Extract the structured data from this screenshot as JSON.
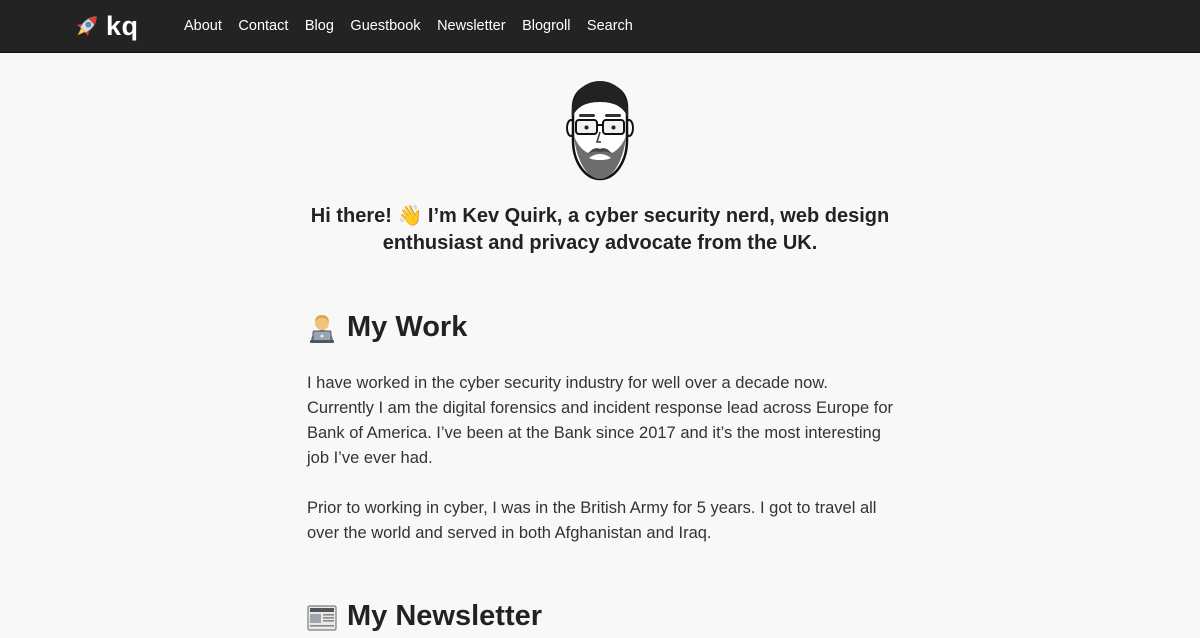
{
  "header": {
    "logo_text": "kq",
    "logo_icon": "rocket-icon",
    "nav": [
      {
        "label": "About"
      },
      {
        "label": "Contact"
      },
      {
        "label": "Blog"
      },
      {
        "label": "Guestbook"
      },
      {
        "label": "Newsletter"
      },
      {
        "label": "Blogroll"
      },
      {
        "label": "Search"
      }
    ]
  },
  "intro": {
    "part1": "Hi there! ",
    "wave": "👋",
    "part2": " I’m Kev Quirk, a cyber security nerd, web design enthusiast and privacy advocate from the UK."
  },
  "work": {
    "icon": "technologist-icon",
    "heading": "My Work",
    "paragraphs": [
      "I have worked in the cyber security industry for well over a decade now. Currently I am the digital forensics and incident response lead across Europe for Bank of America. I’ve been at the Bank since 2017 and it’s the most interesting job I’ve ever had.",
      "Prior to working in cyber, I was in the British Army for 5 years. I got to travel all over the world and served in both Afghanistan and Iraq."
    ]
  },
  "newsletter": {
    "icon": "newspaper-icon",
    "heading": "My Newsletter"
  },
  "colors": {
    "header_bg": "#232323",
    "page_bg": "#f8f8f8",
    "text": "#222222"
  }
}
